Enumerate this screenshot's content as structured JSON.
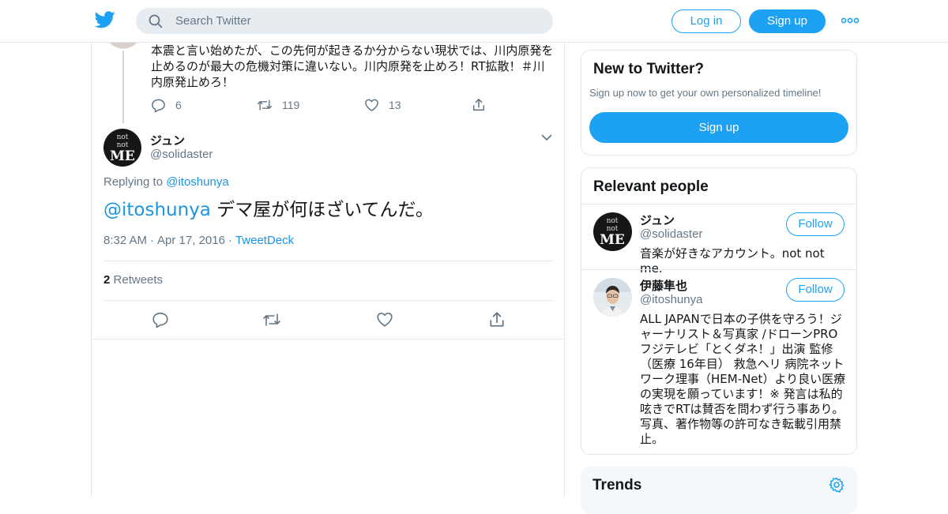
{
  "header": {
    "search_placeholder": "Search Twitter",
    "login_label": "Log in",
    "signup_label": "Sign up"
  },
  "previous_tweet": {
    "text": "本震と言い始めたが、この先何が起きるか分からない現状では、川内原発を止めるのが最大の危機対策に違いない。川内原発を止めろ！RT拡散！＃川内原発止めろ！",
    "replies": "6",
    "retweets": "119",
    "likes": "13"
  },
  "tweet": {
    "name": "ジュン",
    "handle": "@solidaster",
    "replying_label": "Replying to",
    "replying_to": "@itoshunya",
    "mention": "@itoshunya",
    "text": " デマ屋が何ほざいてんだ。",
    "time": "8:32 AM",
    "date": "Apr 17, 2016",
    "source": "TweetDeck",
    "retweet_count": "2",
    "retweet_label": "Retweets"
  },
  "sidebar": {
    "new_title": "New to Twitter?",
    "new_sub": "Sign up now to get your own personalized timeline!",
    "new_signup": "Sign up",
    "relevant_title": "Relevant people",
    "people": [
      {
        "name": "ジュン",
        "handle": "@solidaster",
        "follow": "Follow",
        "bio": "音楽が好きなアカウント。not not me."
      },
      {
        "name": "伊藤隼也",
        "handle": "@itoshunya",
        "follow": "Follow",
        "bio": "ALL JAPANで日本の子供を守ろう！ジャーナリスト＆写真家 /ドローンPRO フジテレビ「とくダネ！」出演 監修（医療 16年目） 救急ヘリ 病院ネットワーク理事（HEM-Net）より良い医療の実現を願っています！※ 発言は私的呟きでRTは賛否を問わず行う事あり。写真、著作物等の許可なき転載引用禁止。"
      }
    ],
    "trends_title": "Trends"
  },
  "avatar_text": {
    "line1": "not",
    "line2": "not",
    "line3": "ME"
  },
  "colors": {
    "accent": "#1da1f2",
    "link": "#1b95e0",
    "muted": "#657786",
    "border": "#e1e8ed"
  },
  "icons": [
    "twitter-bird-icon",
    "search-icon",
    "more-dots-icon",
    "reply-icon",
    "retweet-icon",
    "like-icon",
    "share-icon",
    "chevron-down-icon",
    "settings-gear-icon"
  ]
}
